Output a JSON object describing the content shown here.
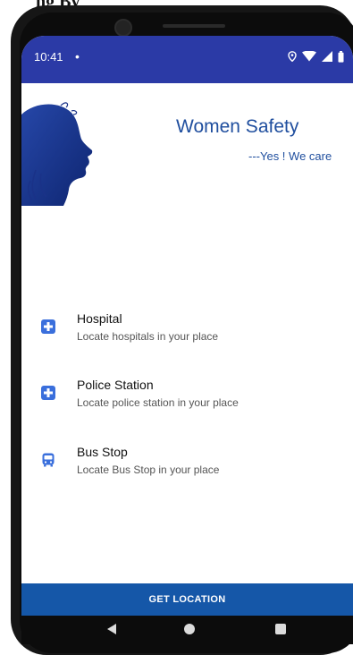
{
  "page_fragment": "ng By",
  "status_bar": {
    "time": "10:41",
    "dot": "•",
    "icons": [
      "location-icon",
      "wifi-icon",
      "signal-icon",
      "battery-icon"
    ]
  },
  "header": {
    "title": "Women Safety",
    "tagline": "---Yes ! We care"
  },
  "list": [
    {
      "icon": "hospital-plus-icon",
      "title": "Hospital",
      "desc": "Locate hospitals in your place"
    },
    {
      "icon": "police-plus-icon",
      "title": "Police Station",
      "desc": "Locate police station in your place"
    },
    {
      "icon": "bus-icon",
      "title": "Bus Stop",
      "desc": "Locate Bus Stop in your place"
    }
  ],
  "button": {
    "label": "GET LOCATION"
  },
  "nav": [
    "back-icon",
    "home-icon",
    "recents-icon"
  ],
  "colors": {
    "status_bar": "#2b3aa6",
    "accent": "#1f4e9e",
    "button": "#1557a8",
    "icon": "#3a6fdc"
  }
}
